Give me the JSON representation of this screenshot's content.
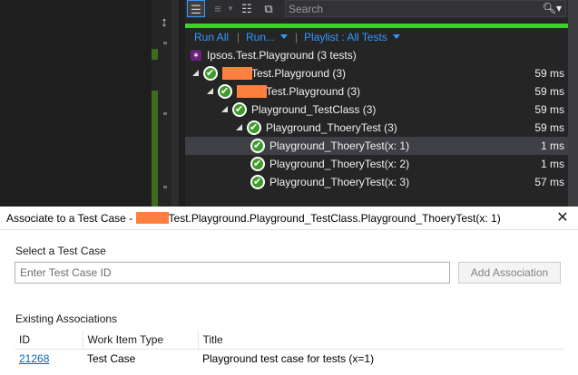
{
  "explorer": {
    "search_placeholder": "Search",
    "progress_percent": 100,
    "commands": {
      "run_all": "Run All",
      "run": "Run...",
      "playlist": "Playlist : All Tests"
    },
    "playlist_header": "Ipsos.Test.Playground (3 tests)",
    "tree": [
      {
        "label": "Test.Playground (3)",
        "time": "59 ms",
        "depth": 0,
        "expandable": true,
        "redacted": true
      },
      {
        "label": "Test.Playground (3)",
        "time": "59 ms",
        "depth": 1,
        "expandable": true,
        "redacted": true
      },
      {
        "label": "Playground_TestClass (3)",
        "time": "59 ms",
        "depth": 2,
        "expandable": true,
        "redacted": false
      },
      {
        "label": "Playground_ThoeryTest (3)",
        "time": "59 ms",
        "depth": 3,
        "expandable": true,
        "redacted": false
      },
      {
        "label": "Playground_ThoeryTest(x: 1)",
        "time": "1 ms",
        "depth": 4,
        "expandable": false,
        "redacted": false,
        "selected": true
      },
      {
        "label": "Playground_ThoeryTest(x: 2)",
        "time": "1 ms",
        "depth": 4,
        "expandable": false,
        "redacted": false
      },
      {
        "label": "Playground_ThoeryTest(x: 3)",
        "time": "57 ms",
        "depth": 4,
        "expandable": false,
        "redacted": false
      }
    ]
  },
  "dialog": {
    "title_prefix": "Associate to a Test Case -",
    "title_suffix": "Test.Playground.Playground_TestClass.Playground_ThoeryTest(x: 1)",
    "select_label": "Select a Test Case",
    "input_placeholder": "Enter Test Case ID",
    "input_value": "",
    "add_button": "Add Association",
    "existing_label": "Existing Associations",
    "columns": [
      "ID",
      "Work Item Type",
      "Title"
    ],
    "rows": [
      {
        "id": "21268",
        "type": "Test Case",
        "title": "Playground test case for tests (x=1)"
      }
    ]
  },
  "colors": {
    "accent": "#3399ff",
    "pass": "#3e9b2a",
    "progress": "#3ed12e",
    "redaction": "#ff7f3f",
    "link": "#0066cc"
  },
  "icons": [
    "splitter-icon",
    "group-by-icon",
    "sort-icon",
    "list-icon",
    "copy-window-icon",
    "search-icon",
    "vs-test-icon",
    "passed-test-icon",
    "close-icon"
  ]
}
